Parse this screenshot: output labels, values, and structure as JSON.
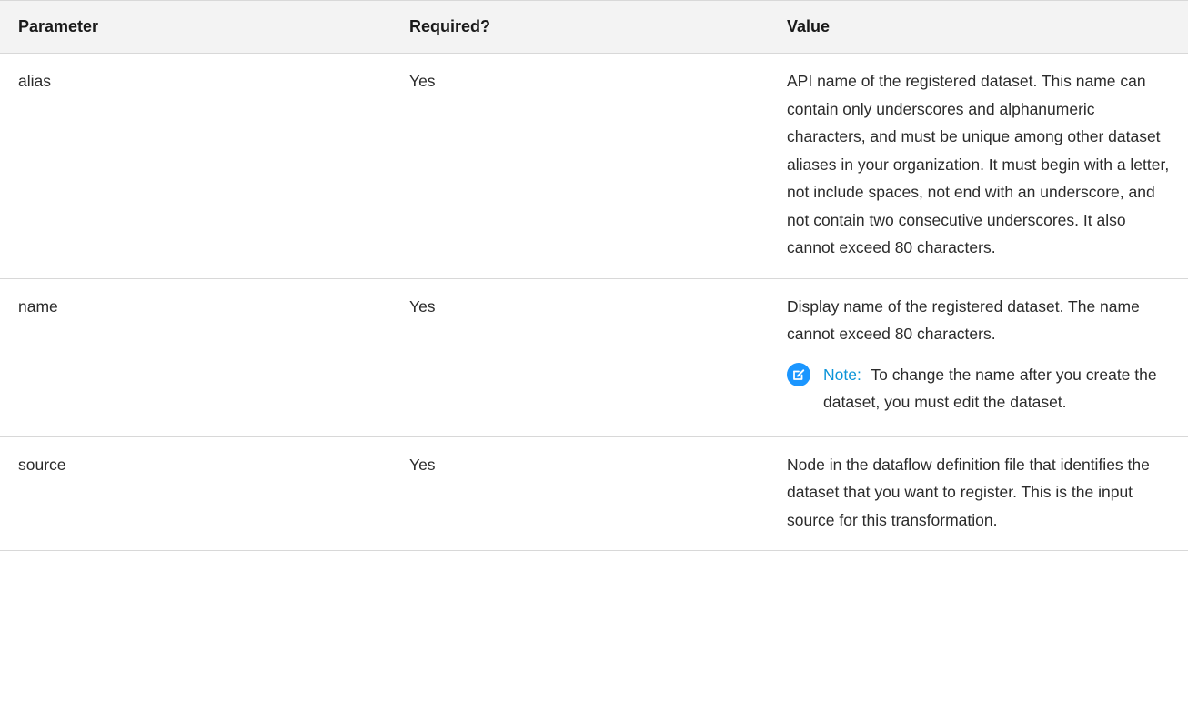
{
  "table": {
    "headers": {
      "parameter": "Parameter",
      "required": "Required?",
      "value": "Value"
    },
    "rows": [
      {
        "parameter": "alias",
        "required": "Yes",
        "value": "API name of the registered dataset. This name can contain only underscores and alphanumeric characters, and must be unique among other dataset aliases in your organization. It must begin with a letter, not include spaces, not end with an underscore, and not contain two consecutive underscores. It also cannot exceed 80 characters."
      },
      {
        "parameter": "name",
        "required": "Yes",
        "value": "Display name of the registered dataset. The name cannot exceed 80 characters.",
        "note": {
          "icon": "edit-note-icon",
          "label": "Note:",
          "text": "To change the name after you create the dataset, you must edit the dataset."
        }
      },
      {
        "parameter": "source",
        "required": "Yes",
        "value": "Node in the dataflow definition file that identifies the dataset that you want to register. This is the input source for this transformation."
      }
    ]
  },
  "colors": {
    "header_background": "#f3f3f3",
    "note_icon": "#1b96ff",
    "note_label": "#0b94d8",
    "border": "#d8d8d8"
  }
}
